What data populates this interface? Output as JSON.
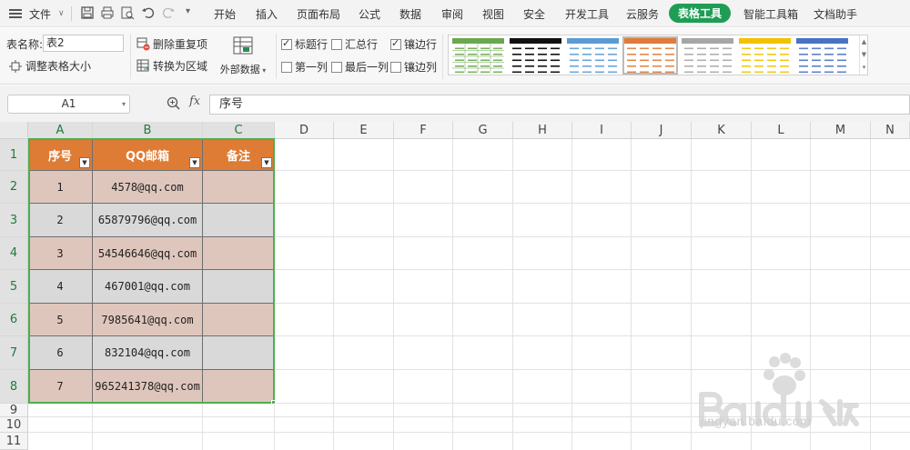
{
  "menubar": {
    "file_label": "文件",
    "tabs": [
      "开始",
      "插入",
      "页面布局",
      "公式",
      "数据",
      "审阅",
      "视图",
      "安全",
      "开发工具",
      "云服务"
    ],
    "active_tab": "表格工具",
    "tabs_right": [
      "智能工具箱",
      "文档助手"
    ]
  },
  "ribbon": {
    "table_name_label": "表名称:",
    "table_name_value": "表2",
    "resize_label": "调整表格大小",
    "remove_dup_label": "删除重复项",
    "convert_label": "转换为区域",
    "external_data_label": "外部数据",
    "options": [
      {
        "label": "标题行",
        "checked": true
      },
      {
        "label": "汇总行",
        "checked": false
      },
      {
        "label": "镶边行",
        "checked": true
      },
      {
        "label": "第一列",
        "checked": false
      },
      {
        "label": "最后一列",
        "checked": false
      },
      {
        "label": "镶边列",
        "checked": false
      }
    ],
    "style_colors": [
      "#6aa84f",
      "#111111",
      "#5b9bd5",
      "#e07b39",
      "#a6a6a6",
      "#f2c200",
      "#4a72c4"
    ],
    "selected_style_index": 3
  },
  "formula": {
    "name_box": "A1",
    "fx_label": "fx",
    "value": "序号"
  },
  "grid": {
    "columns": [
      "A",
      "B",
      "C",
      "D",
      "E",
      "F",
      "G",
      "H",
      "I",
      "J",
      "K",
      "L",
      "M",
      "N"
    ],
    "rows": [
      "1",
      "2",
      "3",
      "4",
      "5",
      "6",
      "7",
      "8",
      "9",
      "10",
      "11"
    ],
    "table": {
      "headers": [
        "序号",
        "QQ邮箱",
        "备注"
      ],
      "rows": [
        [
          "1",
          "4578@qq.com",
          ""
        ],
        [
          "2",
          "65879796@qq.com",
          ""
        ],
        [
          "3",
          "54546646@qq.com",
          ""
        ],
        [
          "4",
          "467001@qq.com",
          ""
        ],
        [
          "5",
          "7985641@qq.com",
          ""
        ],
        [
          "6",
          "832104@qq.com",
          ""
        ],
        [
          "7",
          "965241378@qq.com",
          ""
        ]
      ],
      "header_color": "#de7b34",
      "band_odd_color": "#dfc6bc",
      "band_even_color": "#d9d9d9"
    }
  },
  "watermark": {
    "text": "jingyan.baidu.com"
  }
}
